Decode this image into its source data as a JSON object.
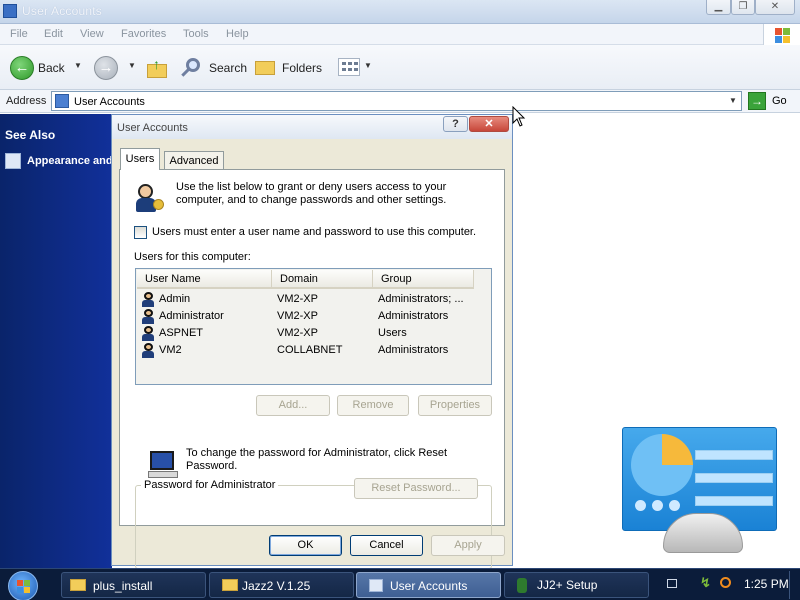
{
  "window": {
    "title": "User Accounts"
  },
  "menu": [
    "File",
    "Edit",
    "View",
    "Favorites",
    "Tools",
    "Help"
  ],
  "toolbar": {
    "back_label": "Back",
    "search_label": "Search",
    "folders_label": "Folders"
  },
  "address": {
    "label": "Address",
    "value": "User Accounts",
    "go_label": "Go"
  },
  "left_pane": {
    "heading": "See Also",
    "link": "Appearance and"
  },
  "dialog": {
    "title": "User Accounts",
    "help_glyph": "?",
    "close_glyph": "✕",
    "tabs": [
      "Users",
      "Advanced"
    ],
    "intro": "Use the list below to grant or deny users access to your computer, and to change passwords and other settings.",
    "checkbox_label": "Users must enter a user name and password to use this computer.",
    "users_label": "Users for this computer:",
    "columns": [
      "User Name",
      "Domain",
      "Group"
    ],
    "users": [
      {
        "name": "Admin",
        "domain": "VM2-XP",
        "group": "Administrators; ..."
      },
      {
        "name": "Administrator",
        "domain": "VM2-XP",
        "group": "Administrators"
      },
      {
        "name": "ASPNET",
        "domain": "VM2-XP",
        "group": "Users"
      },
      {
        "name": "VM2",
        "domain": "COLLABNET",
        "group": "Administrators"
      }
    ],
    "list_buttons": {
      "add": "Add...",
      "remove": "Remove",
      "properties": "Properties"
    },
    "password_group": {
      "legend": "Password for Administrator",
      "text": "To change the password for Administrator, click Reset Password.",
      "reset_button": "Reset Password..."
    },
    "footer_buttons": {
      "ok": "OK",
      "cancel": "Cancel",
      "apply": "Apply"
    }
  },
  "taskbar": {
    "items": [
      "plus_install",
      "Jazz2 V.1.25",
      "User Accounts",
      "JJ2+ Setup"
    ],
    "clock": "1:25 PM"
  },
  "colors": {
    "taskbar": "#0b1c3a",
    "selected_task": "#3f5f93",
    "left_pane": "#0a246a",
    "dialog_bg": "#ece9d8"
  }
}
